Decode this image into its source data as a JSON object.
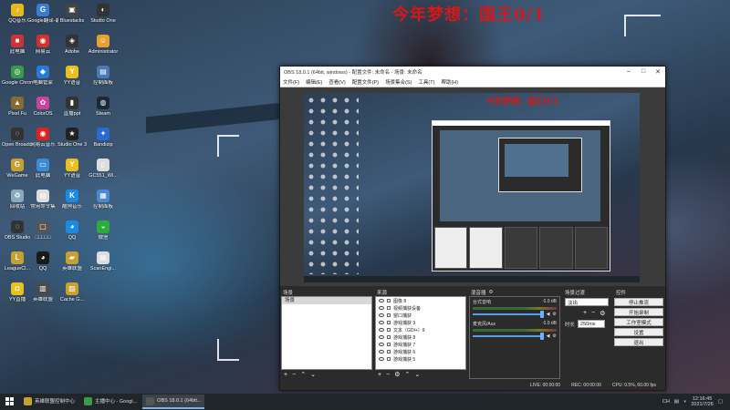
{
  "desktop": {
    "overlay_title": "今年梦想：国王0/1",
    "icons": [
      {
        "label": "QQ音乐",
        "icon": "music-icon",
        "color": "#e8b820",
        "glyph": "♪"
      },
      {
        "label": "Google翻译-最佳手机",
        "icon": "translate-icon",
        "color": "#3a7bd5",
        "glyph": "G"
      },
      {
        "label": "Bluestacks",
        "icon": "bluestacks-icon",
        "color": "#444",
        "glyph": "▣"
      },
      {
        "label": "Studio One",
        "icon": "studio-icon",
        "color": "#333",
        "glyph": "◐"
      },
      {
        "label": "此电脑",
        "icon": "computer-icon",
        "color": "#c33",
        "glyph": "■"
      },
      {
        "label": "网易云",
        "icon": "netease-icon",
        "color": "#c33",
        "glyph": "◉"
      },
      {
        "label": "Adobe",
        "icon": "adobe-icon",
        "color": "#333",
        "glyph": "◈"
      },
      {
        "label": "Administrator",
        "icon": "user-icon",
        "color": "#e8a030",
        "glyph": "☺"
      },
      {
        "label": "Google Chrome",
        "icon": "chrome-icon",
        "color": "#3a9a4a",
        "glyph": "◎"
      },
      {
        "label": "电脑管家",
        "icon": "shield-icon",
        "color": "#2a7ad5",
        "glyph": "◆"
      },
      {
        "label": "YY语音",
        "icon": "yy-icon",
        "color": "#e8c020",
        "glyph": "Y"
      },
      {
        "label": "控制面板",
        "icon": "control-panel-icon",
        "color": "#4a7ab5",
        "glyph": "▤"
      },
      {
        "label": "Pixel Fu",
        "icon": "game-icon",
        "color": "#8a6a30",
        "glyph": "▲"
      },
      {
        "label": "ColorOS",
        "icon": "color-icon",
        "color": "#d040a0",
        "glyph": "✿"
      },
      {
        "label": "直播ppt",
        "icon": "ppt-icon",
        "color": "#333",
        "glyph": "▮"
      },
      {
        "label": "Steam",
        "icon": "steam-icon",
        "color": "#1b2838",
        "glyph": "◍"
      },
      {
        "label": "Open Broadcast",
        "icon": "obs-icon",
        "color": "#333",
        "glyph": "◌"
      },
      {
        "label": "网易云音乐",
        "icon": "music-red-icon",
        "color": "#d22",
        "glyph": "◉"
      },
      {
        "label": "Studio One 3",
        "icon": "studio-one-icon",
        "color": "#222",
        "glyph": "★"
      },
      {
        "label": "Bandizip",
        "icon": "zip-icon",
        "color": "#2a6ad5",
        "glyph": "✦"
      },
      {
        "label": "WeGame",
        "icon": "wegame-icon",
        "color": "#c8a030",
        "glyph": "G"
      },
      {
        "label": "此电脑",
        "icon": "pc-icon",
        "color": "#3a8ad5",
        "glyph": "▭"
      },
      {
        "label": "YY语音",
        "icon": "yy2-icon",
        "color": "#e8c020",
        "glyph": "Y"
      },
      {
        "label": "GC551_Wi...",
        "icon": "file-icon",
        "color": "#ddd",
        "glyph": "▯"
      },
      {
        "label": "回收站",
        "icon": "recycle-icon",
        "color": "#8ab",
        "glyph": "♻"
      },
      {
        "label": "常用命令集",
        "icon": "doc-icon",
        "color": "#ddd",
        "glyph": "▤"
      },
      {
        "label": "酷狗音乐",
        "icon": "kugou-icon",
        "color": "#1a8ae5",
        "glyph": "K"
      },
      {
        "label": "控制面板",
        "icon": "panel-icon",
        "color": "#4a8ad5",
        "glyph": "▦"
      },
      {
        "label": "OBS Studio",
        "icon": "obs-studio-icon",
        "color": "#333",
        "glyph": "◌"
      },
      {
        "label": "□□□□□",
        "icon": "app-icon",
        "color": "#555",
        "glyph": "▢"
      },
      {
        "label": "QQ",
        "icon": "qq-icon",
        "color": "#1a8ae5",
        "glyph": "◕"
      },
      {
        "label": "微信",
        "icon": "wechat-icon",
        "color": "#2aae3a",
        "glyph": "◒"
      },
      {
        "label": "LeagueCl...",
        "icon": "league-icon",
        "color": "#c8a030",
        "glyph": "L"
      },
      {
        "label": "QQ",
        "icon": "qq2-icon",
        "color": "#1a1a1a",
        "glyph": "◕"
      },
      {
        "label": "英雄联盟",
        "icon": "lol-icon",
        "color": "#c8a030",
        "glyph": "▰"
      },
      {
        "label": "ScanEngi...",
        "icon": "scan-icon",
        "color": "#ddd",
        "glyph": "▤"
      },
      {
        "label": "YY直播",
        "icon": "yy-live-icon",
        "color": "#e8c020",
        "glyph": "◘"
      },
      {
        "label": "英雄联盟",
        "icon": "lol2-icon",
        "color": "#4a4a4a",
        "glyph": "▥"
      },
      {
        "label": "Cache G...",
        "icon": "cache-icon",
        "color": "#c8a030",
        "glyph": "▨"
      }
    ]
  },
  "taskbar": {
    "apps": [
      {
        "label": "英雄联盟控制中心",
        "icon": "lol-tb-icon",
        "color": "#c8a030",
        "active": false
      },
      {
        "label": "主播中心 - Googl...",
        "icon": "chrome-tb-icon",
        "color": "#3a9a4a",
        "active": false
      },
      {
        "label": "OBS 18.0.1 (64bit...",
        "icon": "obs-tb-icon",
        "color": "#555",
        "active": true
      }
    ],
    "tray_text": "CH",
    "time": "12:16:45",
    "date": "2021/7/26"
  },
  "obs": {
    "title": "OBS 18.0.1 (64bit, windows) - 配置文件: 未命名 - 场景: 未命名",
    "menu": [
      "文件(F)",
      "编辑(E)",
      "查看(V)",
      "配置文件(P)",
      "场景集合(S)",
      "工具(T)",
      "帮助(H)"
    ],
    "canvas_title": "今年梦想：国王0/1",
    "scenes": {
      "header": "场景",
      "items": [
        "场景"
      ]
    },
    "sources": {
      "header": "来源",
      "items": [
        "图像 8",
        "视频捕获设备",
        "窗口捕获",
        "游戏捕获 9",
        "文本（GDI+）9",
        "游戏捕获 8",
        "游戏捕获 7",
        "游戏捕获 6",
        "游戏捕获 5"
      ]
    },
    "mixer": {
      "header": "混音器",
      "channels": [
        {
          "name": "台式音响",
          "db": "0.0 dB"
        },
        {
          "name": "麦克风/Aux",
          "db": "0.0 dB"
        }
      ]
    },
    "transitions": {
      "header": "场景过渡",
      "selected": "淡出",
      "duration_label": "时长",
      "duration": "250ms"
    },
    "controls": [
      "停止推流",
      "开始录制",
      "工作室模式",
      "设置",
      "退出"
    ],
    "status": {
      "live": "LIVE: 00:00:00",
      "rec": "REC: 00:00:00",
      "cpu": "CPU: 0.5%, 60.00 fps"
    }
  }
}
